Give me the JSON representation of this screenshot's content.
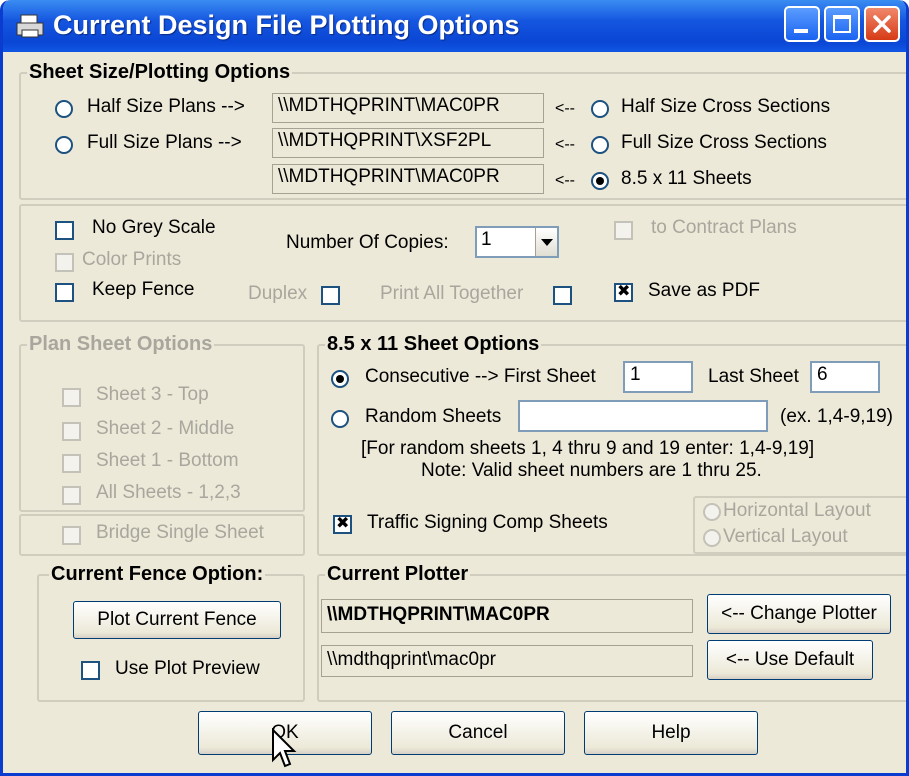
{
  "window": {
    "title": "Current Design File Plotting Options",
    "icon": "printer-icon"
  },
  "sheet_size": {
    "title": "Sheet Size/Plotting Options",
    "half_size_plans": "Half Size Plans -->",
    "full_size_plans": "Full Size Plans -->",
    "printer1": "\\\\MDTHQPRINT\\MAC0PR",
    "printer2": "\\\\MDTHQPRINT\\XSF2PL",
    "printer3": "\\\\MDTHQPRINT\\MAC0PR",
    "arrow": "<--",
    "half_size_cross": "Half Size Cross Sections",
    "full_size_cross": "Full Size Cross Sections",
    "sheets_85x11": "8.5 x 11 Sheets",
    "selected": "8.5 x 11 Sheets"
  },
  "options": {
    "no_grey_scale": "No Grey Scale",
    "color_prints": "Color Prints",
    "keep_fence": "Keep Fence",
    "number_of_copies_label": "Number Of Copies:",
    "number_of_copies_value": "1",
    "duplex": "Duplex",
    "print_all_together": "Print All Together",
    "to_contract_plans": "to Contract Plans",
    "save_as_pdf": "Save as PDF",
    "save_as_pdf_checked": true
  },
  "plan_sheet": {
    "title": "Plan Sheet Options",
    "sheet3": "Sheet 3 - Top",
    "sheet2": "Sheet 2 - Middle",
    "sheet1": "Sheet 1 - Bottom",
    "all_sheets": "All Sheets - 1,2,3",
    "bridge_single": "Bridge Single Sheet"
  },
  "sheet_85_options": {
    "title": "8.5 x 11 Sheet Options",
    "consecutive": "Consecutive --> First Sheet",
    "first_sheet": "1",
    "last_sheet_label": "Last Sheet",
    "last_sheet": "6",
    "random_sheets": "Random Sheets",
    "random_value": "",
    "example": "(ex. 1,4-9,19)",
    "help_line1": "[For random sheets 1, 4 thru 9 and 19 enter:  1,4-9,19]",
    "help_line2": "Note:  Valid sheet numbers are 1 thru 25.",
    "traffic_signing": "Traffic Signing Comp Sheets",
    "traffic_checked": true,
    "horizontal_layout": "Horizontal Layout",
    "vertical_layout": "Vertical Layout",
    "selected": "Consecutive"
  },
  "fence": {
    "title": "Current Fence Option:",
    "plot_button": "Plot Current Fence",
    "use_plot_preview": "Use Plot Preview"
  },
  "plotter": {
    "title": "Current Plotter",
    "current": "\\\\MDTHQPRINT\\MAC0PR",
    "default": "\\\\mdthqprint\\mac0pr",
    "change_button": "<-- Change Plotter",
    "default_button": "<-- Use Default"
  },
  "footer": {
    "ok": "OK",
    "cancel": "Cancel",
    "help": "Help"
  }
}
